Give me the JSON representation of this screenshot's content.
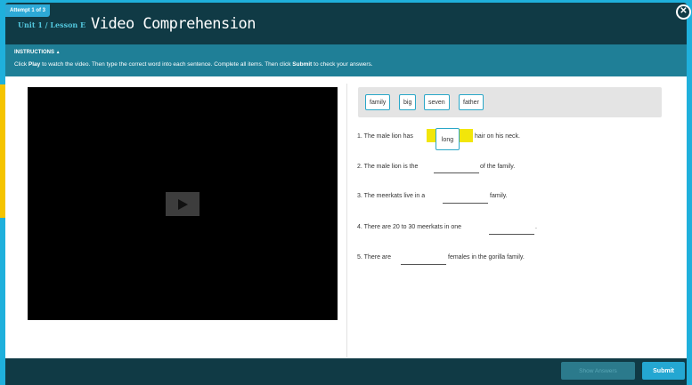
{
  "header": {
    "attempt": "Attempt 1 of 3",
    "unit": "Unit 1 / Lesson E",
    "title": "Video Comprehension"
  },
  "instructions": {
    "heading": "INSTRUCTIONS",
    "text_before": "Click ",
    "play_word": "Play",
    "text_middle": " to watch the video. Then type the correct word into each sentence. Complete all items. Then click ",
    "submit_word": "Submit",
    "text_after": " to check your answers."
  },
  "word_bank": [
    "family",
    "big",
    "seven",
    "father"
  ],
  "sentences": [
    {
      "num": "1.",
      "before": "The male lion has",
      "after": "hair on his neck.",
      "answer": "long"
    },
    {
      "num": "2.",
      "before": "The male lion is the",
      "after": "of the family.",
      "answer": ""
    },
    {
      "num": "3.",
      "before": "The meerkats live in a",
      "after": "family.",
      "answer": ""
    },
    {
      "num": "4.",
      "before": "There are 20 to 30 meerkats in one",
      "after": ".",
      "answer": ""
    },
    {
      "num": "5.",
      "before": "There are",
      "after": "females in the gorilla family.",
      "answer": ""
    }
  ],
  "footer": {
    "show_answers": "Show Answers",
    "submit": "Submit"
  },
  "colors": {
    "header_bg": "#103a45",
    "instructions_bg": "#1f7f97",
    "accent": "#24a7d2",
    "highlight": "#f2e60a"
  }
}
